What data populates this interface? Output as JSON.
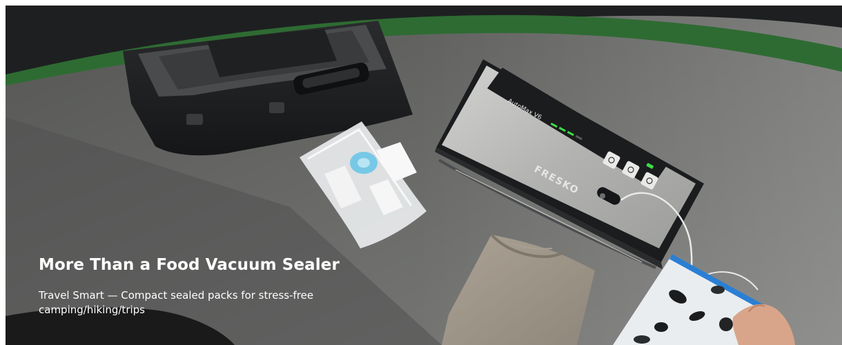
{
  "banner": {
    "headline": "More Than a Food Vacuum Sealer",
    "subtext": "Travel Smart — Compact sealed packs for stress-free camping/hiking/trips"
  },
  "product": {
    "brand": "FRESKO",
    "model": "AutoMax V6"
  },
  "colors": {
    "brand_green": "#2e6b32",
    "background_gray": "#6a6b69",
    "sealer_silver": "#b9bab8",
    "panel_black": "#1b1c1d",
    "indicator_green": "#3ddc4a"
  }
}
